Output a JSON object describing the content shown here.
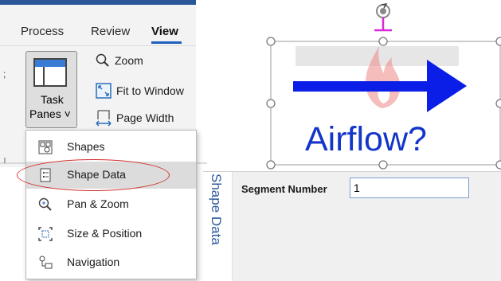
{
  "ribbon": {
    "tabs": [
      "Process",
      "Review",
      "View"
    ],
    "left_fragment": ";",
    "task_panes": {
      "line1": "Task",
      "line2": "Panes ˅"
    },
    "commands": {
      "zoom": "Zoom",
      "fit_to_window": "Fit to Window",
      "page_width": "Page Width"
    }
  },
  "menu": {
    "items": [
      {
        "label": "Shapes",
        "icon": "shapes-window-icon"
      },
      {
        "label": "Shape Data",
        "icon": "shape-data-icon",
        "highlighted": true
      },
      {
        "label": "Pan & Zoom",
        "icon": "pan-zoom-icon"
      },
      {
        "label": "Size & Position",
        "icon": "size-position-icon"
      },
      {
        "label": "Navigation",
        "icon": "navigation-icon"
      }
    ]
  },
  "shape": {
    "text": "Airflow?"
  },
  "pane": {
    "title": "Shape Data",
    "field_label": "Segment Number",
    "field_value": "1"
  },
  "colors": {
    "accent": "#2b579a",
    "arrow": "#0a1ee8",
    "shape_text": "#1436c8",
    "handle_pink": "#d62ad6",
    "annotation": "#d0312d"
  }
}
